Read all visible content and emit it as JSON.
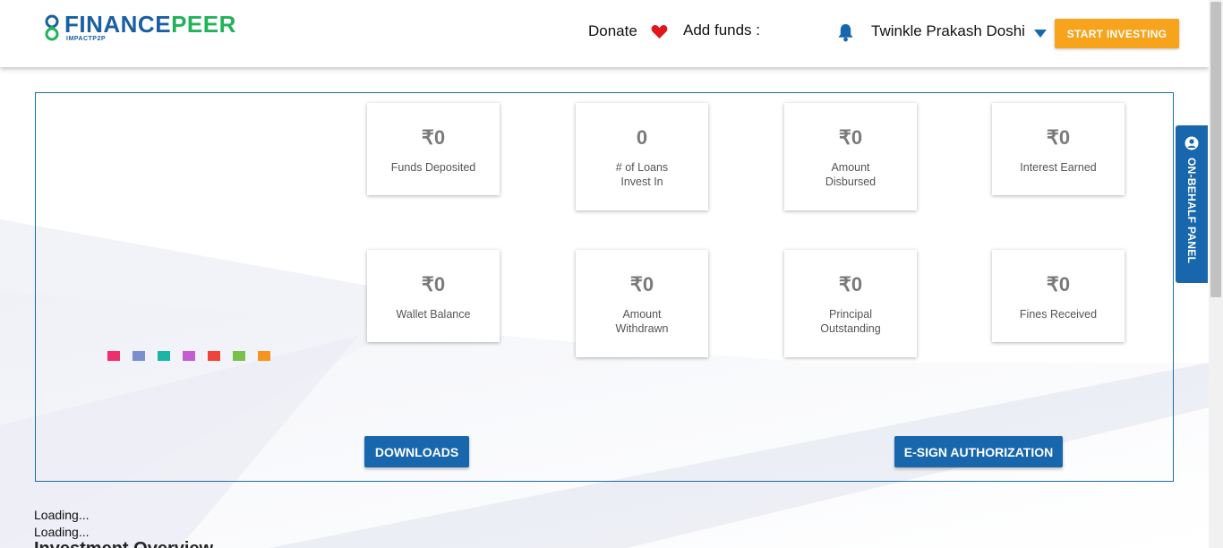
{
  "header": {
    "logo_main_a": "FINANCE",
    "logo_main_b": "PEER",
    "logo_sub": "IMPACTP2P",
    "donate_label": "Donate",
    "add_funds_label": "Add funds :",
    "user_name": "Twinkle Prakash Doshi",
    "start_investing_label": "START INVESTING"
  },
  "stats": [
    {
      "value": "₹0",
      "label": "Funds Deposited"
    },
    {
      "value": "0",
      "label": "# of Loans Invest In"
    },
    {
      "value": "₹0",
      "label": "Amount Disbursed"
    },
    {
      "value": "₹0",
      "label": "Interest Earned"
    },
    {
      "value": "₹0",
      "label": "Wallet Balance"
    },
    {
      "value": "₹0",
      "label": "Amount Withdrawn"
    },
    {
      "value": "₹0",
      "label": "Principal Outstanding"
    },
    {
      "value": "₹0",
      "label": "Fines Received"
    }
  ],
  "buttons": {
    "downloads_label": "DOWNLOADS",
    "esign_label": "E-SIGN AUTHORIZATION"
  },
  "side_panel": {
    "label": "ON-BEHALF PANEL"
  },
  "loading": {
    "line1": "Loading...",
    "line2": "Loading...",
    "cut_heading": "Investment Overview"
  },
  "colors": {
    "brand_blue": "#1867ac",
    "brand_green": "#22b35a",
    "accent_orange": "#f7a31b",
    "heart_red": "#e0161b",
    "loader_dots": [
      "#f02d6e",
      "#7a8fcc",
      "#1bb5a8",
      "#c45ecf",
      "#f0443a",
      "#7bc04a",
      "#f7941d"
    ]
  },
  "icons": {
    "heart": "heart-icon",
    "bell": "bell-icon",
    "caret": "chevron-down-icon",
    "side_panel": "user-circle-icon"
  }
}
